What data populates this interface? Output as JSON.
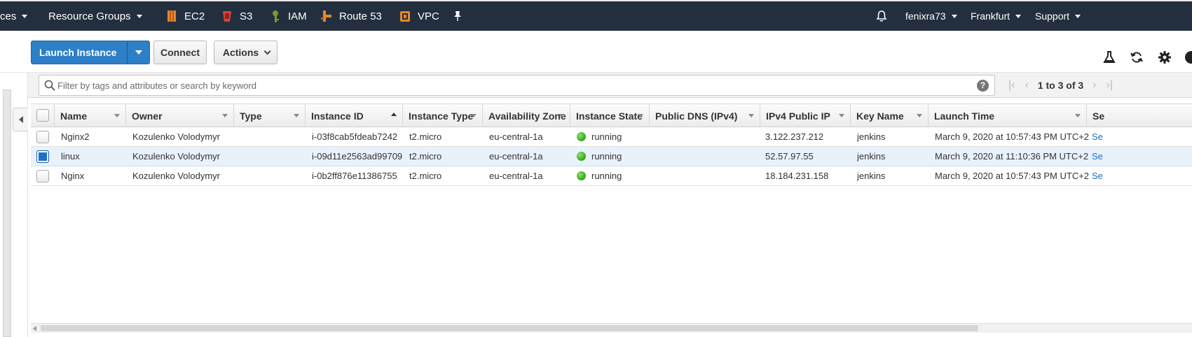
{
  "nav": {
    "services_fragment": "ces",
    "resource_groups": "Resource Groups",
    "shortcuts": [
      {
        "label": "EC2",
        "icon": "ec2-icon"
      },
      {
        "label": "S3",
        "icon": "s3-icon"
      },
      {
        "label": "IAM",
        "icon": "iam-icon"
      },
      {
        "label": "Route 53",
        "icon": "route53-icon"
      },
      {
        "label": "VPC",
        "icon": "vpc-icon"
      }
    ],
    "user": "fenixra73",
    "region": "Frankfurt",
    "support": "Support",
    "colors": {
      "bar": "#232f3e",
      "service_orange": "#e8862a",
      "iam_green": "#6b8e23"
    }
  },
  "toolbar": {
    "launch_label": "Launch Instance",
    "connect_label": "Connect",
    "actions_label": "Actions",
    "icons": [
      "flask-icon",
      "refresh-icon",
      "gear-icon",
      "help-icon"
    ],
    "primary_color": "#2d7fc8"
  },
  "filter": {
    "placeholder": "Filter by tags and attributes or search by keyword",
    "value": "",
    "pager_text": "1 to 3 of 3"
  },
  "table": {
    "columns": [
      "Name",
      "Owner",
      "Type",
      "Instance ID",
      "Instance Type",
      "Availability Zone",
      "Instance State",
      "Public DNS (IPv4)",
      "IPv4 Public IP",
      "Key Name",
      "Launch Time",
      "Se"
    ],
    "rows": [
      {
        "name": "Nginx2",
        "owner": "Kozulenko Volodymyr",
        "type": "",
        "instance_id": "i-03f8cab5fdeab7242",
        "instance_type": "t2.micro",
        "az": "eu-central-1a",
        "state": "running",
        "public_dns": "",
        "public_ip": "3.122.237.212",
        "key_name": "jenkins",
        "launch_time": "March 9, 2020 at 10:57:43 PM UTC+2",
        "sg": "Se",
        "selected": false
      },
      {
        "name": "linux",
        "owner": "Kozulenko Volodymyr",
        "type": "",
        "instance_id": "i-09d11e2563ad99709",
        "instance_type": "t2.micro",
        "az": "eu-central-1a",
        "state": "running",
        "public_dns": "",
        "public_ip": "52.57.97.55",
        "key_name": "jenkins",
        "launch_time": "March 9, 2020 at 11:10:36 PM UTC+2",
        "sg": "Se",
        "selected": true
      },
      {
        "name": "Nginx",
        "owner": "Kozulenko Volodymyr",
        "type": "",
        "instance_id": "i-0b2ff876e11386755",
        "instance_type": "t2.micro",
        "az": "eu-central-1a",
        "state": "running",
        "public_dns": "",
        "public_ip": "18.184.231.158",
        "key_name": "jenkins",
        "launch_time": "March 9, 2020 at 10:57:43 PM UTC+2",
        "sg": "Se",
        "selected": false
      }
    ],
    "state_color": "#2fa915",
    "selected_row_color": "#e9f2fb"
  }
}
